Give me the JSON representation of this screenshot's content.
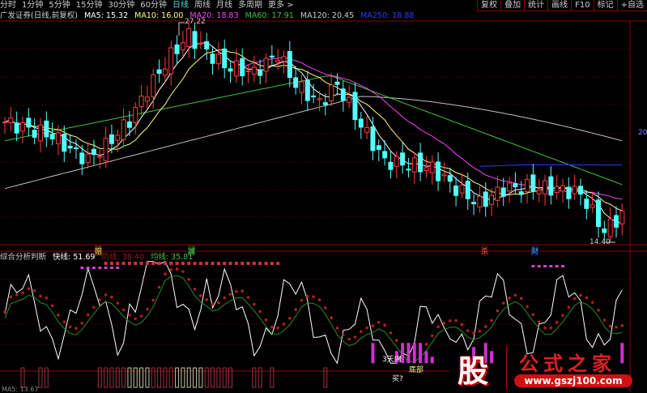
{
  "tabs": [
    "分时",
    "1分钟",
    "5分钟",
    "15分钟",
    "30分钟",
    "60分钟",
    "日线",
    "周线",
    "月线",
    "多周期",
    "更多 >"
  ],
  "active_tab": "日线",
  "toolbar": [
    "复权",
    "叠加",
    "统计",
    "画线",
    "F10",
    "标记",
    "+自选"
  ],
  "main_info": {
    "title": "广发证券(日线,前复权)",
    "ma5": "MA5: 15.32",
    "ma10": "MA10: 16.00",
    "ma20": "MA20: 18.83",
    "ma60": "MA60: 17.91",
    "ma120": "MA120: 20.45",
    "ma250": "MA250: 18.88"
  },
  "colors": {
    "up": "#ff3c3c",
    "down": "#54ffff",
    "ma5": "#ffffff",
    "ma10": "#ffff80",
    "ma20": "#ff40ff",
    "ma60": "#40c040",
    "ma120": "#c0c0c0",
    "ma250": "#2040ff",
    "grid": "#7a0000"
  },
  "high_label": "27.22",
  "low_label": "14.40",
  "right_axis_label": "20",
  "markers": [
    {
      "text": "赔",
      "color": "#ffd070"
    },
    {
      "text": "减",
      "color": "#60d060"
    },
    {
      "text": "杀",
      "color": "#ff6060"
    },
    {
      "text": "财",
      "color": "#60a0ff"
    }
  ],
  "sub_info": {
    "title": "综合分析判断",
    "fast": "快线: 51.69",
    "defense": "防线: 38.40",
    "balance": "均线: 35.81"
  },
  "sub_labels": {
    "within3": "3天内",
    "bottom": "底部",
    "buy": "买?"
  },
  "bottom_info": "MA5: 13.67",
  "logo": {
    "char": "股",
    "name": "公式之家",
    "url": "www.gszj100.com"
  },
  "price_keypoints": [
    [
      0,
      21.4
    ],
    [
      8,
      20.6
    ],
    [
      11,
      19.8
    ],
    [
      14,
      19.2
    ],
    [
      17,
      20.0
    ],
    [
      21,
      21.5
    ],
    [
      24,
      23.3
    ],
    [
      28,
      25.3
    ],
    [
      31,
      26.5
    ],
    [
      33,
      25.8
    ],
    [
      37,
      24.7
    ],
    [
      42,
      24.3
    ],
    [
      46,
      25.4
    ],
    [
      49,
      23.6
    ],
    [
      53,
      22.5
    ],
    [
      56,
      23.6
    ],
    [
      60,
      21.2
    ],
    [
      64,
      19.1
    ],
    [
      68,
      18.9
    ],
    [
      72,
      18.7
    ],
    [
      76,
      17.5
    ],
    [
      80,
      16.6
    ],
    [
      84,
      17.5
    ],
    [
      88,
      17.6
    ],
    [
      93,
      17.5
    ],
    [
      97,
      17.2
    ],
    [
      101,
      15.0
    ],
    [
      104,
      16.0
    ]
  ]
}
